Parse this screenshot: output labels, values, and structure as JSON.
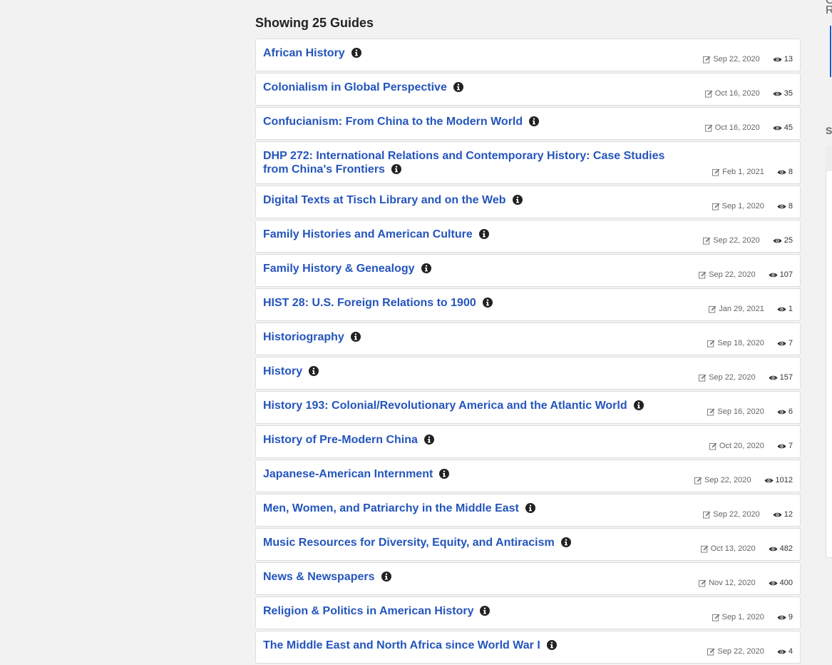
{
  "heading": "Showing 25 Guides",
  "guides": [
    {
      "title": "African History",
      "date": "Sep 22, 2020",
      "views": "13"
    },
    {
      "title": "Colonialism in Global Perspective",
      "date": "Oct 16, 2020",
      "views": "35"
    },
    {
      "title": "Confucianism: From China to the Modern World",
      "date": "Oct 16, 2020",
      "views": "45"
    },
    {
      "title": "DHP 272: International Relations and Contemporary History: Case Studies from China's Frontiers",
      "date": "Feb 1, 2021",
      "views": "8"
    },
    {
      "title": "Digital Texts at Tisch Library and on the Web",
      "date": "Sep 1, 2020",
      "views": "8"
    },
    {
      "title": "Family Histories and American Culture",
      "date": "Sep 22, 2020",
      "views": "25"
    },
    {
      "title": "Family History & Genealogy",
      "date": "Sep 22, 2020",
      "views": "107"
    },
    {
      "title": "HIST 28: U.S. Foreign Relations to 1900",
      "date": "Jan 29, 2021",
      "views": "1"
    },
    {
      "title": "Historiography",
      "date": "Sep 18, 2020",
      "views": "7"
    },
    {
      "title": "History",
      "date": "Sep 22, 2020",
      "views": "157"
    },
    {
      "title": "History 193: Colonial/Revolutionary America and the Atlantic World",
      "date": "Sep 16, 2020",
      "views": "6"
    },
    {
      "title": "History of Pre-Modern China",
      "date": "Oct 20, 2020",
      "views": "7"
    },
    {
      "title": "Japanese-American Internment",
      "date": "Sep 22, 2020",
      "views": "1012"
    },
    {
      "title": "Men, Women, and Patriarchy in the Middle East",
      "date": "Sep 22, 2020",
      "views": "12"
    },
    {
      "title": "Music Resources for Diversity, Equity, and Antiracism",
      "date": "Oct 13, 2020",
      "views": "482"
    },
    {
      "title": "News & Newspapers",
      "date": "Nov 12, 2020",
      "views": "400"
    },
    {
      "title": "Religion & Politics in American History",
      "date": "Sep 1, 2020",
      "views": "9"
    },
    {
      "title": "The Middle East and North Africa since World War I",
      "date": "Sep 22, 2020",
      "views": "4"
    }
  ],
  "rail": {
    "c1": "C",
    "c2": "R",
    "c3": "S"
  },
  "colors": {
    "link": "#2455bd",
    "background": "#f2f2f2"
  },
  "icons": {
    "info": "info-circle-icon",
    "edit": "edit-icon",
    "views": "eye-icon"
  }
}
